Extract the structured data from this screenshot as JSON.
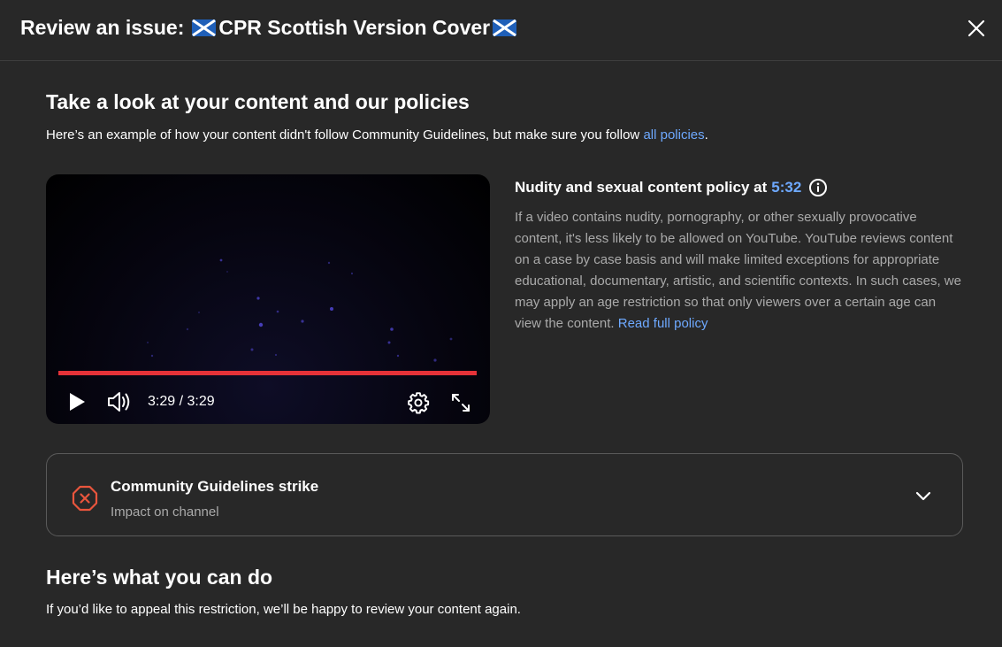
{
  "header": {
    "title_prefix": "Review an issue:",
    "video_title": "CPR Scottish Version Cover",
    "close_icon": "close-icon"
  },
  "policies_section": {
    "title": "Take a look at your content and our policies",
    "subtitle_before": "Here’s an example of how your content didn't follow Community Guidelines, but make sure you follow",
    "link": "all policies",
    "subtitle_after": "."
  },
  "player": {
    "current_time": "3:29",
    "separator": "/",
    "duration": "3:29",
    "progress": 1.0,
    "progress_color": "#e53238",
    "icons": [
      "play-icon",
      "volume-icon",
      "settings-icon",
      "fullscreen-icon"
    ]
  },
  "policy": {
    "title": "Nudity and sexual content policy at",
    "timestamp": "5:32",
    "body": "If a video contains nudity, pornography, or other sexually provocative content, it's less likely to be allowed on YouTube. YouTube reviews content on a case by case basis and will make limited exceptions for appropriate educational, documentary, artistic, and scientific contexts. In such cases, we may apply an age restriction so that only viewers over a certain age can view the content.",
    "link": "Read full policy"
  },
  "strike": {
    "title": "Community Guidelines strike",
    "subtitle": "Impact on channel",
    "icon_color": "#e9553d"
  },
  "actions_section": {
    "title": "Here’s what you can do",
    "subtitle": "If you’d like to appeal this restriction, we’ll be happy to review your content again."
  },
  "colors": {
    "background": "#282828",
    "link": "#6ea9ff",
    "secondary_text": "#aaaaaa"
  }
}
